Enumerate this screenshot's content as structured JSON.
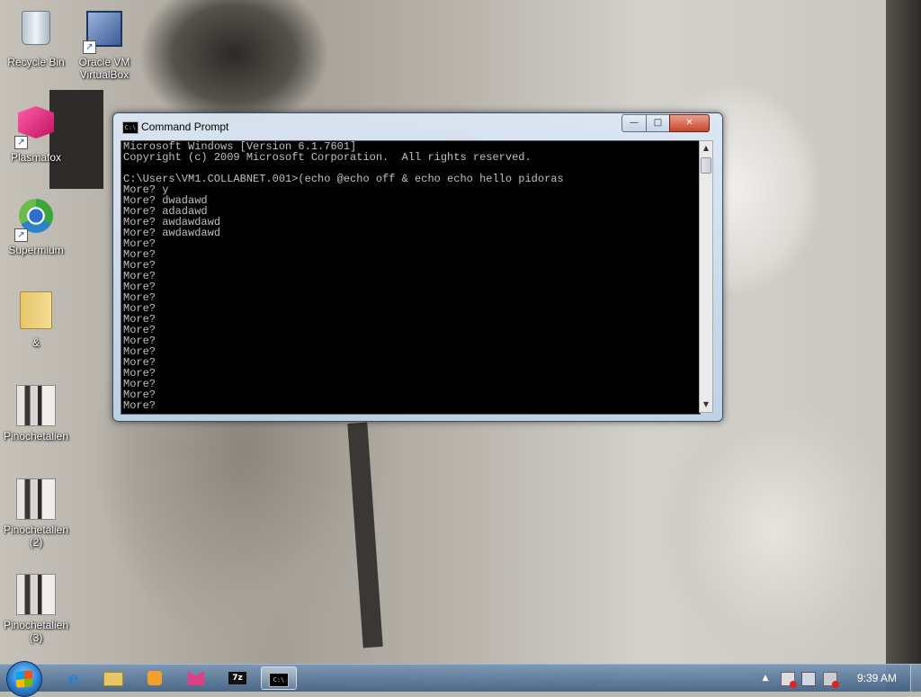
{
  "desktop": {
    "icons": [
      {
        "label": "Recycle Bin",
        "icon": "recycle-bin-icon"
      },
      {
        "label": "Oracle VM VirtualBox",
        "icon": "virtualbox-icon"
      },
      {
        "label": "Plasmafox",
        "icon": "plasmafox-icon"
      },
      {
        "label": "Supermium",
        "icon": "supermium-icon"
      },
      {
        "label": "&",
        "icon": "folder-icon"
      },
      {
        "label": "Pinochetalien",
        "icon": "image-file-icon"
      },
      {
        "label": "Pinochetalien (2)",
        "icon": "image-file-icon"
      },
      {
        "label": "Pinochetalien (3)",
        "icon": "image-file-icon"
      }
    ]
  },
  "window": {
    "title": "Command Prompt",
    "icon_text": "C:\\",
    "controls": {
      "minimize": "—",
      "maximize": "□",
      "close": "✕"
    },
    "console_lines": [
      "Microsoft Windows [Version 6.1.7601]",
      "Copyright (c) 2009 Microsoft Corporation.  All rights reserved.",
      "",
      "C:\\Users\\VM1.COLLABNET.001>(echo @echo off & echo echo hello pidoras",
      "More? y",
      "More? dwadawd",
      "More? adadawd",
      "More? awdawdawd",
      "More? awdawdawd",
      "More?",
      "More?",
      "More?",
      "More?",
      "More?",
      "More?",
      "More?",
      "More?",
      "More?",
      "More?",
      "More?",
      "More?",
      "More?",
      "More?",
      "More?",
      "More?"
    ],
    "scrollbar": {
      "up": "▲",
      "down": "▼"
    }
  },
  "taskbar": {
    "items": [
      {
        "name": "internet-explorer",
        "icon": "ie-icon",
        "text": "e"
      },
      {
        "name": "windows-explorer",
        "icon": "folder-icon"
      },
      {
        "name": "media-player",
        "icon": "media-player-icon"
      },
      {
        "name": "plasmafox",
        "icon": "plasmafox-icon"
      },
      {
        "name": "7-zip",
        "icon": "7zip-icon",
        "text": "7z"
      },
      {
        "name": "command-prompt",
        "icon": "cmd-icon",
        "text": "C:\\",
        "active": true
      }
    ],
    "tray": {
      "show_hidden": "▲",
      "icons": [
        "action-center-icon",
        "network-icon",
        "volume-icon"
      ]
    },
    "clock": "9:39 AM"
  },
  "colors": {
    "console_bg": "#000000",
    "console_text": "#c0c0c0",
    "close_button": "#c7442b",
    "taskbar": "#46648a"
  }
}
